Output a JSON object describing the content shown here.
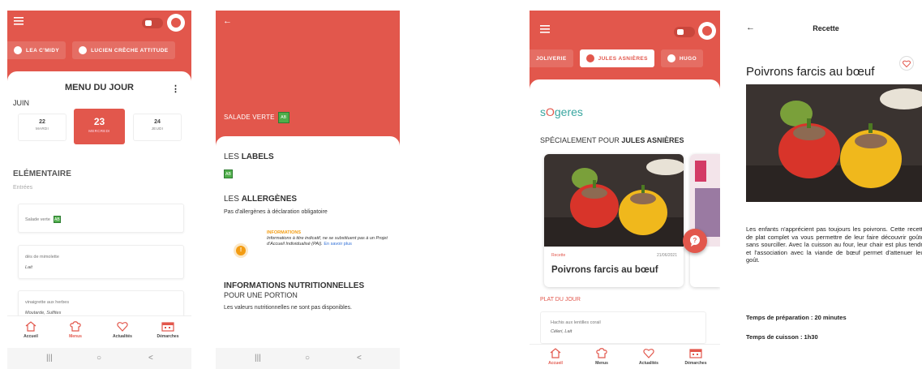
{
  "screen1": {
    "children": [
      {
        "name": "LEA C'MIDY"
      },
      {
        "name": "LUCIEN CRÈCHE ATTITUDE"
      }
    ],
    "menu_title": "MENU DU JOUR",
    "month": "JUIN",
    "days": [
      {
        "num": "22",
        "weekday": "MARDI"
      },
      {
        "num": "23",
        "weekday": "MERCREDI",
        "selected": true
      },
      {
        "num": "24",
        "weekday": "JEUDI"
      }
    ],
    "level": "ELÉMENTAIRE",
    "section": "Entrées",
    "dishes": [
      {
        "name": "Salade verte",
        "allergens": ""
      },
      {
        "name": "dès de mimolette",
        "allergens": "Lait"
      },
      {
        "name": "vinaigrette aux herbes",
        "allergens": "Moutarde,  Sulfites"
      }
    ],
    "tabs": [
      "Accueil",
      "Menus",
      "Actualités",
      "Démarches"
    ],
    "active_tab": "Menus"
  },
  "screen2": {
    "dish_name": "SALADE VERTE",
    "labels_title_a": "LES ",
    "labels_title_b": "LABELS",
    "allergens_title_a": "LES ",
    "allergens_title_b": "ALLERGÈNES",
    "allergens_text": "Pas d'allergènes à déclaration obligatoire",
    "info_title": "INFORMATIONS",
    "info_text": "Informations à titre indicatif, ne se substituent pas à un Projet d'Accueil Individualisé (PAI).",
    "info_link": "En savoir plus",
    "nutrition_title": "INFORMATIONS NUTRITIONNELLES",
    "nutrition_sub": "POUR UNE PORTION",
    "nutrition_text": "Les valeurs nutritionnelles ne sont pas disponibles."
  },
  "screen3": {
    "children": [
      {
        "name": "JOLIVERIE"
      },
      {
        "name": "JULES ASNIÈRES",
        "selected": true
      },
      {
        "name": "HUGO"
      }
    ],
    "brand_a": "s",
    "brand_b": "O",
    "brand_c": "geres",
    "special_prefix": "SPÉCIALEMENT POUR ",
    "special_name": "JULES ASNIÈRES",
    "recipe_tag": "Recette",
    "recipe_date": "21/06/2021",
    "recipe_title": "Poivrons farcis au bœuf",
    "plat_du_jour": "PLAT DU JOUR",
    "plat_name": "Hachis aux lentilles corail",
    "plat_allergens": "Céleri,  Lait",
    "tabs": [
      "Accueil",
      "Menus",
      "Actualités",
      "Démarches"
    ],
    "active_tab": "Accueil"
  },
  "screen4": {
    "header_title": "Recette",
    "title": "Poivrons farcis au bœuf",
    "description": "Les enfants n'apprécient pas toujours les poivrons. Cette recette de plat complet va vous permettre de leur faire découvrir goûter sans sourciller. Avec la cuisson au four, leur chair est plus tendre et l'association avec la viande de bœuf permet d'attenuer leur goût.",
    "prep_time": "Temps de préparation : 20 minutes",
    "cook_time": "Temps de cuisson : 1h30"
  },
  "colors": {
    "brand_red": "#e2574c",
    "bio_green": "#4fae4a",
    "info_orange": "#f39c12",
    "link_blue": "#2f6fd6"
  },
  "icons": [
    "hamburger-icon",
    "school-icon",
    "user-icon",
    "back-arrow-icon",
    "home-icon",
    "chef-hat-icon",
    "heart-icon",
    "calendar-icon",
    "info-icon",
    "chat-icon",
    "kebab-icon"
  ]
}
